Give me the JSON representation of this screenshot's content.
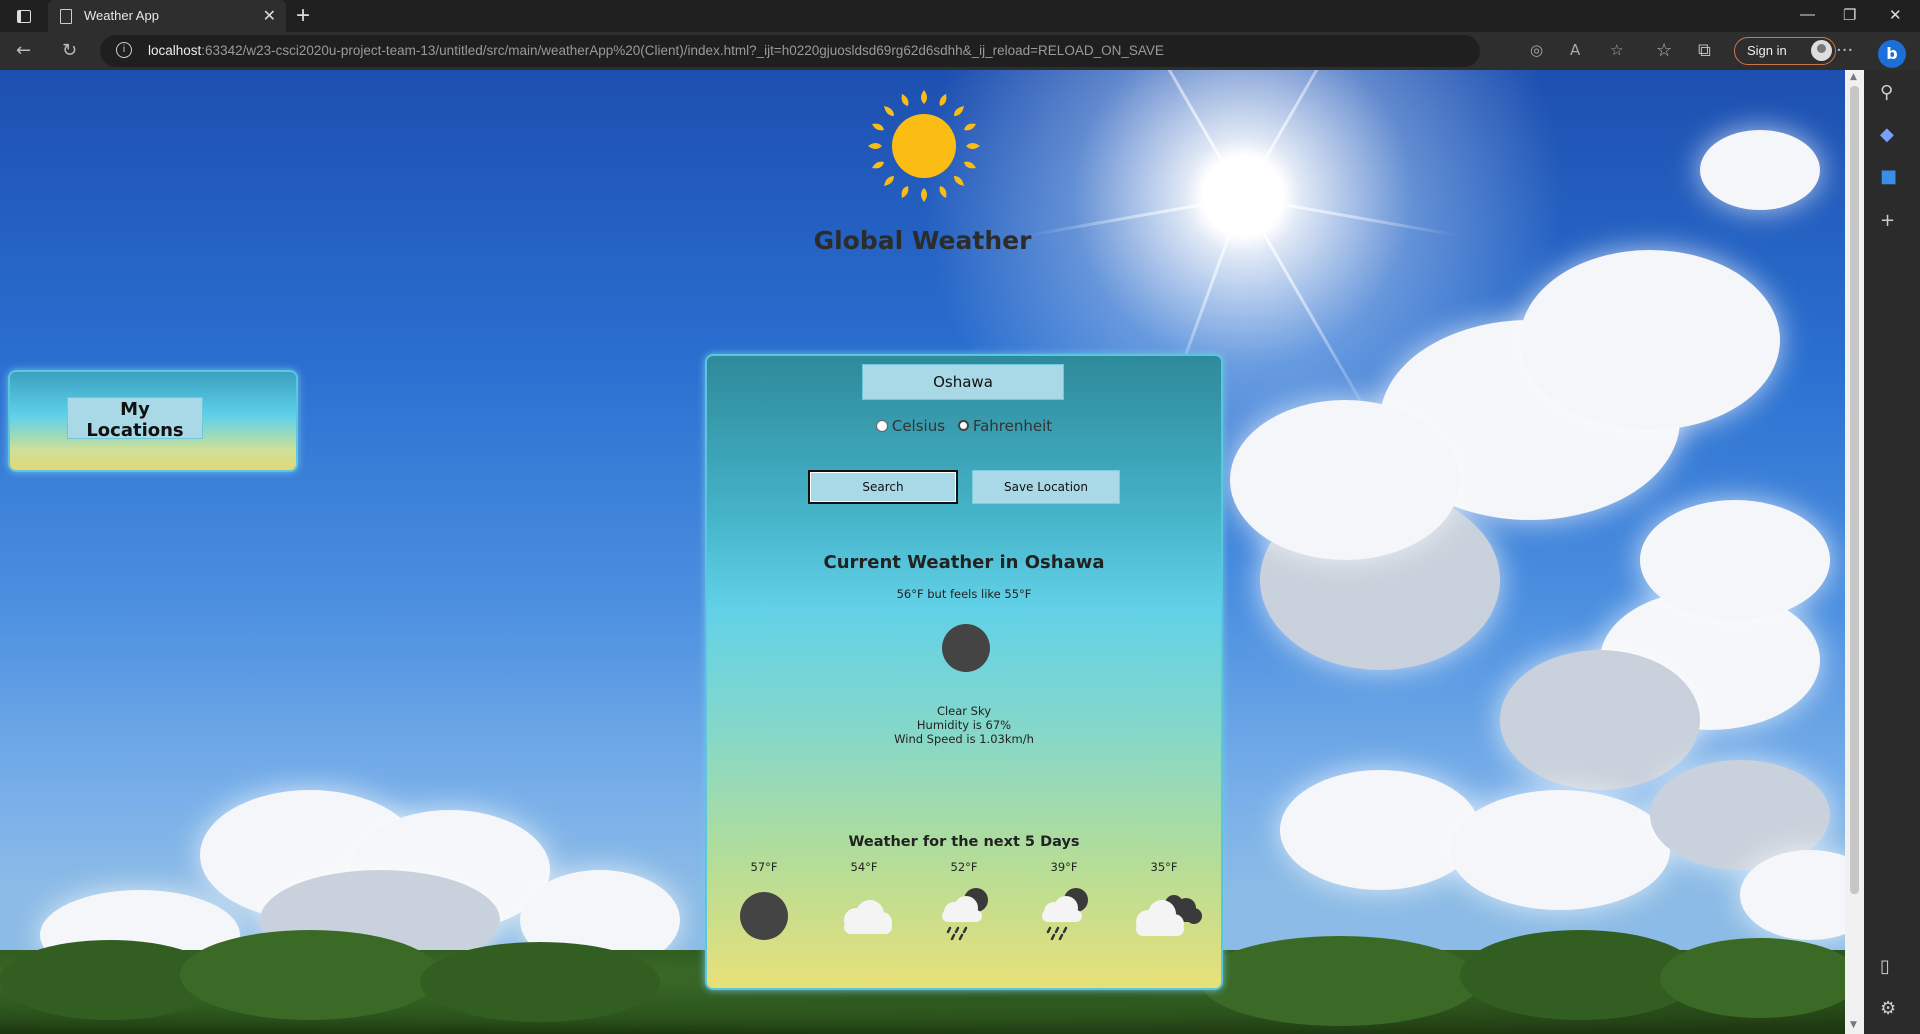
{
  "browser": {
    "tab_title": "Weather App",
    "url_host": "localhost",
    "url_rest": ":63342/w23-csci2020u-project-team-13/untitled/src/main/weatherApp%20(Client)/index.html?_ijt=h0220gjuosldsd69rg62d6sdhh&_ij_reload=RELOAD_ON_SAVE",
    "sign_in": "Sign in"
  },
  "header": {
    "title": "Global Weather",
    "logo_icon": "sun-icon"
  },
  "sidebar": {
    "my_locations": "My Locations"
  },
  "search": {
    "city_value": "Oshawa",
    "units": [
      {
        "label": "Celsius",
        "selected": false
      },
      {
        "label": "Fahrenheit",
        "selected": true
      }
    ],
    "search_button": "Search",
    "save_button": "Save Location"
  },
  "current": {
    "title": "Current Weather in Oshawa",
    "temp_line": "56°F but feels like 55°F",
    "icon": "moon-icon",
    "description": "Clear Sky",
    "humidity": "Humidity is 67%",
    "wind": "Wind Speed is 1.03km/h"
  },
  "forecast": {
    "title": "Weather for the next 5 Days",
    "days": [
      {
        "temp": "57°F",
        "icon": "moon-icon"
      },
      {
        "temp": "54°F",
        "icon": "cloud-icon"
      },
      {
        "temp": "52°F",
        "icon": "night-rain-icon"
      },
      {
        "temp": "39°F",
        "icon": "night-rain-icon"
      },
      {
        "temp": "35°F",
        "icon": "night-clouds-icon"
      }
    ]
  },
  "colors": {
    "accent": "#a9d8e6",
    "panel_border": "#5ac6e0",
    "sun": "#fbbd14"
  }
}
